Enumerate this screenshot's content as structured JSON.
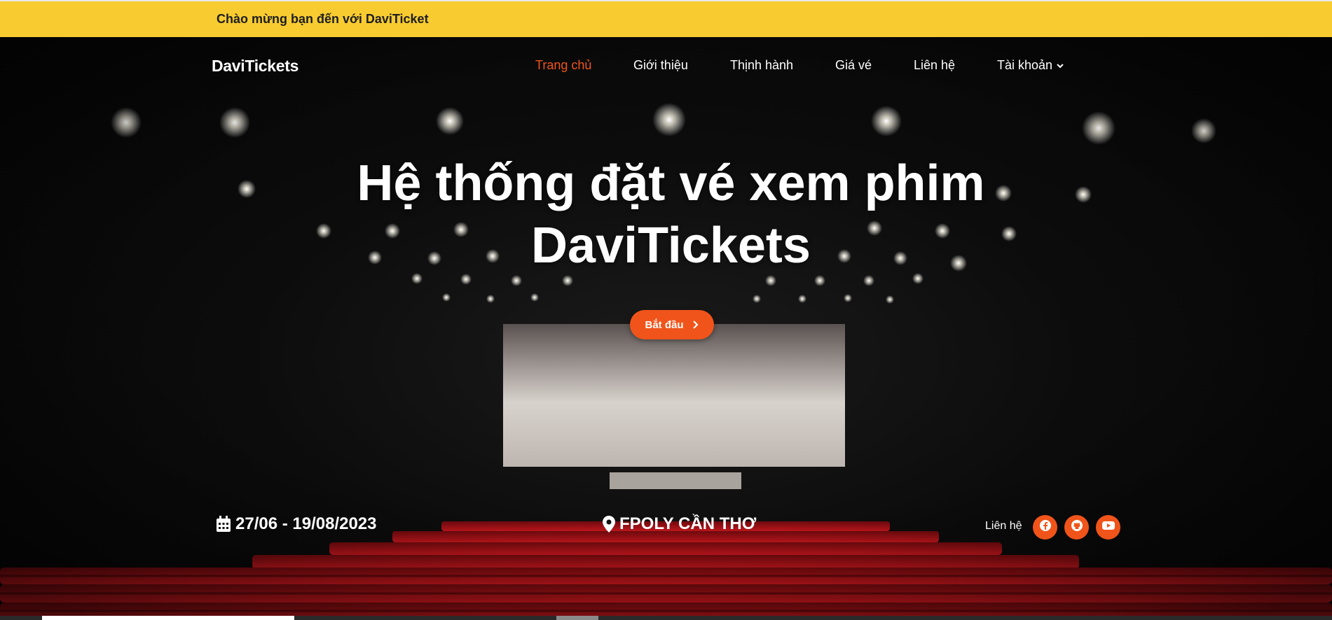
{
  "topbar": {
    "welcome": "Chào mừng bạn đến với DaviTicket"
  },
  "brand": "DaviTickets",
  "nav": {
    "items": [
      {
        "label": "Trang chủ",
        "active": true
      },
      {
        "label": "Giới thiệu",
        "active": false
      },
      {
        "label": "Thịnh hành",
        "active": false
      },
      {
        "label": "Giá vé",
        "active": false
      },
      {
        "label": "Liên hệ",
        "active": false
      },
      {
        "label": "Tài khoản",
        "active": false,
        "icon": "chevron-down-icon"
      }
    ]
  },
  "hero": {
    "title_line1": "Hệ thống đặt vé xem phim",
    "title_line2": "DaviTickets",
    "cta_label": "Bắt đầu",
    "cta_icon": "chevron-right-icon"
  },
  "info": {
    "date": "27/06 - 19/08/2023",
    "date_icon": "calendar-icon",
    "location": "FPOLY CẦN THƠ",
    "location_icon": "map-pin-icon"
  },
  "social": {
    "label": "Liên hệ",
    "icons": [
      "facebook-icon",
      "github-icon",
      "youtube-icon"
    ]
  },
  "colors": {
    "accent": "#f0541a",
    "topbar": "#f8cc30",
    "seat": "#b3151a"
  }
}
